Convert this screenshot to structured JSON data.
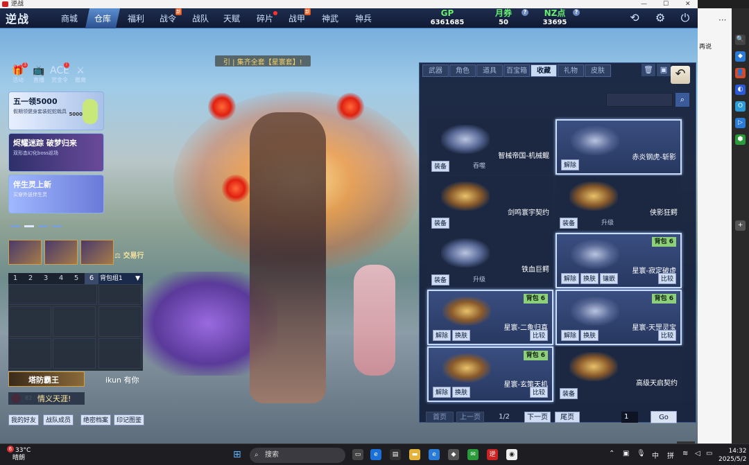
{
  "window": {
    "title": "逆战",
    "minimize": "—",
    "maximize": "☐",
    "close": "✕"
  },
  "logo": "逆战",
  "nav": [
    {
      "label": "商城",
      "badge": ""
    },
    {
      "label": "仓库",
      "badge": "",
      "active": true
    },
    {
      "label": "福利",
      "badge": ""
    },
    {
      "label": "战令",
      "badge": "新"
    },
    {
      "label": "战队",
      "badge": ""
    },
    {
      "label": "天赋",
      "badge": ""
    },
    {
      "label": "碎片",
      "badge": "dot"
    },
    {
      "label": "战甲",
      "badge": "新"
    },
    {
      "label": "神武",
      "badge": ""
    },
    {
      "label": "神兵",
      "badge": ""
    }
  ],
  "currencies": [
    {
      "key": "GP",
      "value": "6361685"
    },
    {
      "key": "月券",
      "value": "50",
      "info": "?"
    },
    {
      "key": "NZ点",
      "value": "33695",
      "info": "?"
    }
  ],
  "sys_icons": [
    "refresh-icon",
    "gear-icon",
    "power-icon"
  ],
  "notice": "引 | 集齐全套【星寰套】!",
  "left_icons": [
    {
      "glyph": "🎁",
      "label": "活动",
      "badge": "3"
    },
    {
      "glyph": "📺",
      "label": "直播",
      "badge": ""
    },
    {
      "glyph": "ACE",
      "label": "赏金令",
      "badge": "!"
    },
    {
      "glyph": "⚔",
      "label": "撤离",
      "badge": ""
    }
  ],
  "promos": [
    {
      "title": "五一领5000",
      "sub": "假期领健身套装蛇蛇戟具",
      "amount": "5000"
    },
    {
      "title": "烬耀迷踪 破梦归来",
      "sub": "双形态幻化boss巡场"
    },
    {
      "title": "伴生灵上新",
      "sub": "买穿外送伴生灵"
    }
  ],
  "trade": "交易行",
  "bag_numbers": [
    "1",
    "2",
    "3",
    "4",
    "5",
    "6"
  ],
  "bag_selected": "6",
  "bag_group": "背包组1",
  "chat": {
    "line1": "塔防霸王",
    "line1b": "ikun",
    "line1c": "有你",
    "level": "82",
    "line2": "情义天涯!"
  },
  "bottom_buttons": [
    "我的好友",
    "战队成员",
    "绝密档案",
    "印记图鉴"
  ],
  "panel_tabs": [
    {
      "label": "武器"
    },
    {
      "label": "角色"
    },
    {
      "label": "道具"
    },
    {
      "label": "百宝箱"
    },
    {
      "label": "收藏",
      "active": true
    },
    {
      "label": "礼物"
    },
    {
      "label": "皮肤"
    }
  ],
  "items": [
    {
      "name": "智械帝国-机械鲲",
      "bag": "",
      "buttons": [
        "装备"
      ],
      "text": "吞噬",
      "highlight": false,
      "img": "silver"
    },
    {
      "name": "赤炎钢虎-斩影",
      "bag": "",
      "buttons": [
        "解除"
      ],
      "text": "",
      "highlight": true,
      "img": "silver"
    },
    {
      "name": "剑鸣寰宇契约",
      "bag": "",
      "buttons": [
        "装备"
      ],
      "text": "",
      "highlight": false,
      "img": "gold"
    },
    {
      "name": "侠影狂鳄",
      "bag": "",
      "buttons": [
        "装备"
      ],
      "text": "升级",
      "highlight": false,
      "img": "gold"
    },
    {
      "name": "铁血巨鳄",
      "bag": "",
      "buttons": [
        "装备"
      ],
      "text": "升级",
      "highlight": false,
      "img": "silver"
    },
    {
      "name": "星寰-寂定破虚",
      "bag": "背包 6",
      "buttons": [
        "解除",
        "换肤",
        "镶嵌"
      ],
      "compare": "比较",
      "highlight": true,
      "img": "silver"
    },
    {
      "name": "星寰-二象归真",
      "bag": "背包 6",
      "buttons": [
        "解除",
        "换肤"
      ],
      "compare": "比较",
      "highlight": true,
      "img": "gold"
    },
    {
      "name": "星寰-天罡灵宝",
      "bag": "背包 6",
      "buttons": [
        "解除",
        "换肤"
      ],
      "compare": "比较",
      "highlight": true,
      "img": "silver"
    },
    {
      "name": "星寰-玄策天机",
      "bag": "背包 6",
      "buttons": [
        "解除",
        "换肤"
      ],
      "compare": "比较",
      "highlight": true,
      "img": "gold"
    },
    {
      "name": "高级天启契约",
      "bag": "",
      "buttons": [
        "装备"
      ],
      "text": "",
      "highlight": false,
      "img": "gold"
    }
  ],
  "pager": {
    "first": "首页",
    "prev": "上一页",
    "page": "1/2",
    "next": "下一页",
    "last": "尾页",
    "input": "1",
    "go": "Go"
  },
  "browser_strip": {
    "text": "再说",
    "dots": "···"
  },
  "sidebar_icons": [
    "🔍",
    "◆",
    "👤",
    "◐",
    "O",
    "▷",
    "⬢",
    "+"
  ],
  "taskbar": {
    "weather_temp": "33°C",
    "weather_desc": "晴朗",
    "weather_badge": "6",
    "search": "搜索",
    "ime": "中",
    "ime2": "拼",
    "time": "14:32",
    "date": "2025/5/2"
  },
  "colors": {
    "accent": "#3b6ab0",
    "gp": "#66f06e",
    "bag_badge": "#8cd07a",
    "notice": "#f6d36a"
  }
}
